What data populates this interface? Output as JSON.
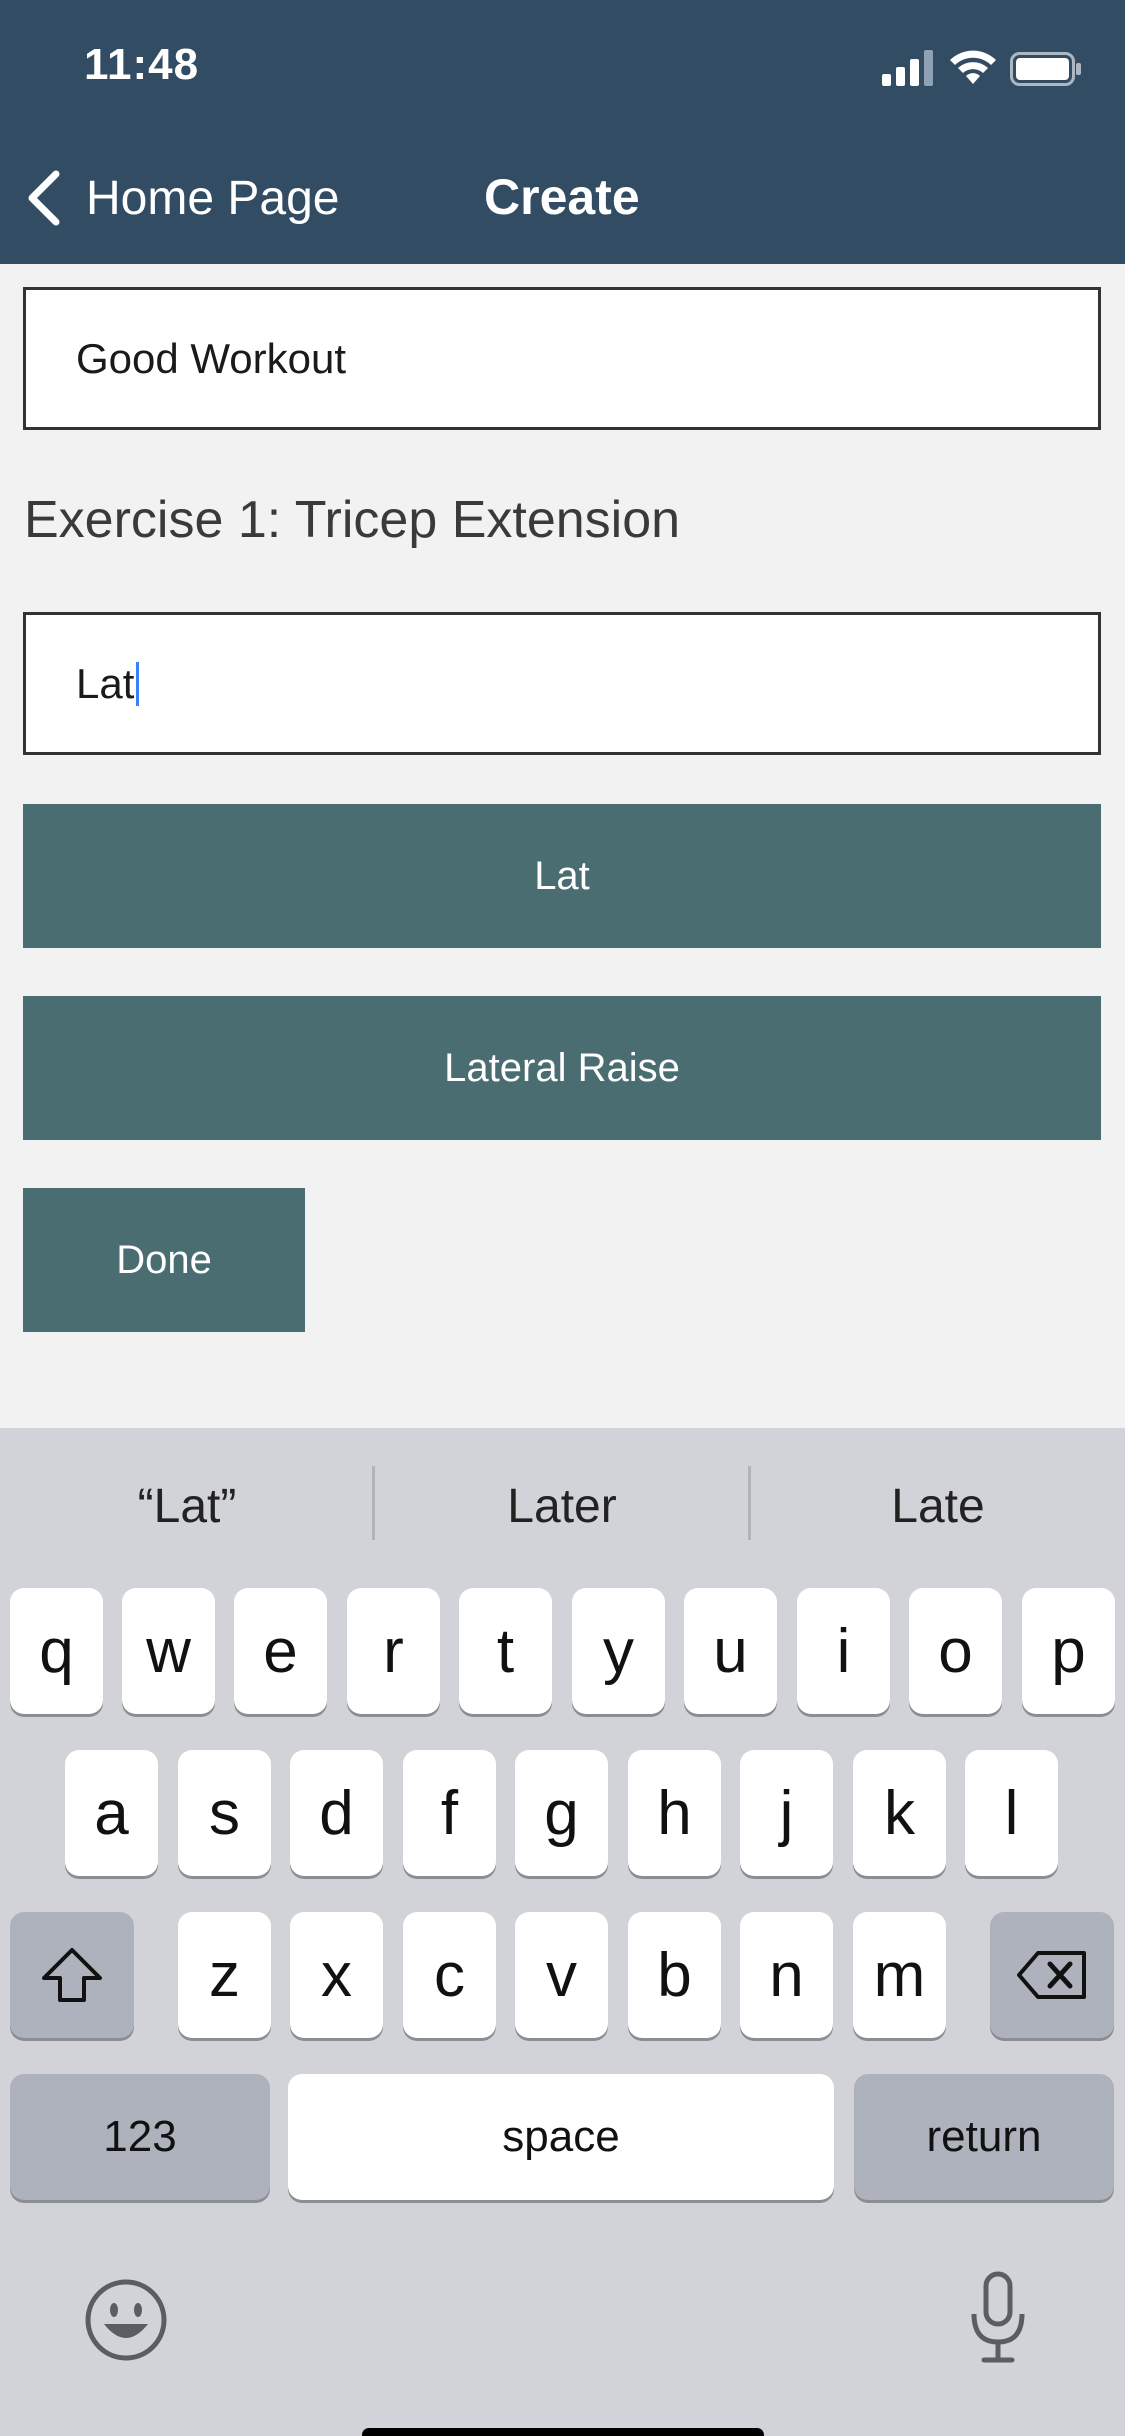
{
  "status_bar": {
    "time": "11:48"
  },
  "nav": {
    "back_label": "Home Page",
    "title": "Create"
  },
  "workout_name_input": {
    "value": "Good Workout"
  },
  "exercise": {
    "title": "Exercise 1: Tricep Extension"
  },
  "exercise_search_input": {
    "value": "Lat"
  },
  "suggestion_buttons": [
    "Lat",
    "Lateral Raise"
  ],
  "done_label": "Done",
  "keyboard": {
    "suggestions": [
      "“Lat”",
      "Later",
      "Late"
    ],
    "row1": [
      "q",
      "w",
      "e",
      "r",
      "t",
      "y",
      "u",
      "i",
      "o",
      "p"
    ],
    "row2": [
      "a",
      "s",
      "d",
      "f",
      "g",
      "h",
      "j",
      "k",
      "l"
    ],
    "row3": [
      "z",
      "x",
      "c",
      "v",
      "b",
      "n",
      "m"
    ],
    "numbers_label": "123",
    "space_label": "space",
    "return_label": "return"
  },
  "colors": {
    "header": "#324c64",
    "button": "#4a6d71",
    "background": "#f2f2f2",
    "keyboard": "#d1d3d9"
  }
}
